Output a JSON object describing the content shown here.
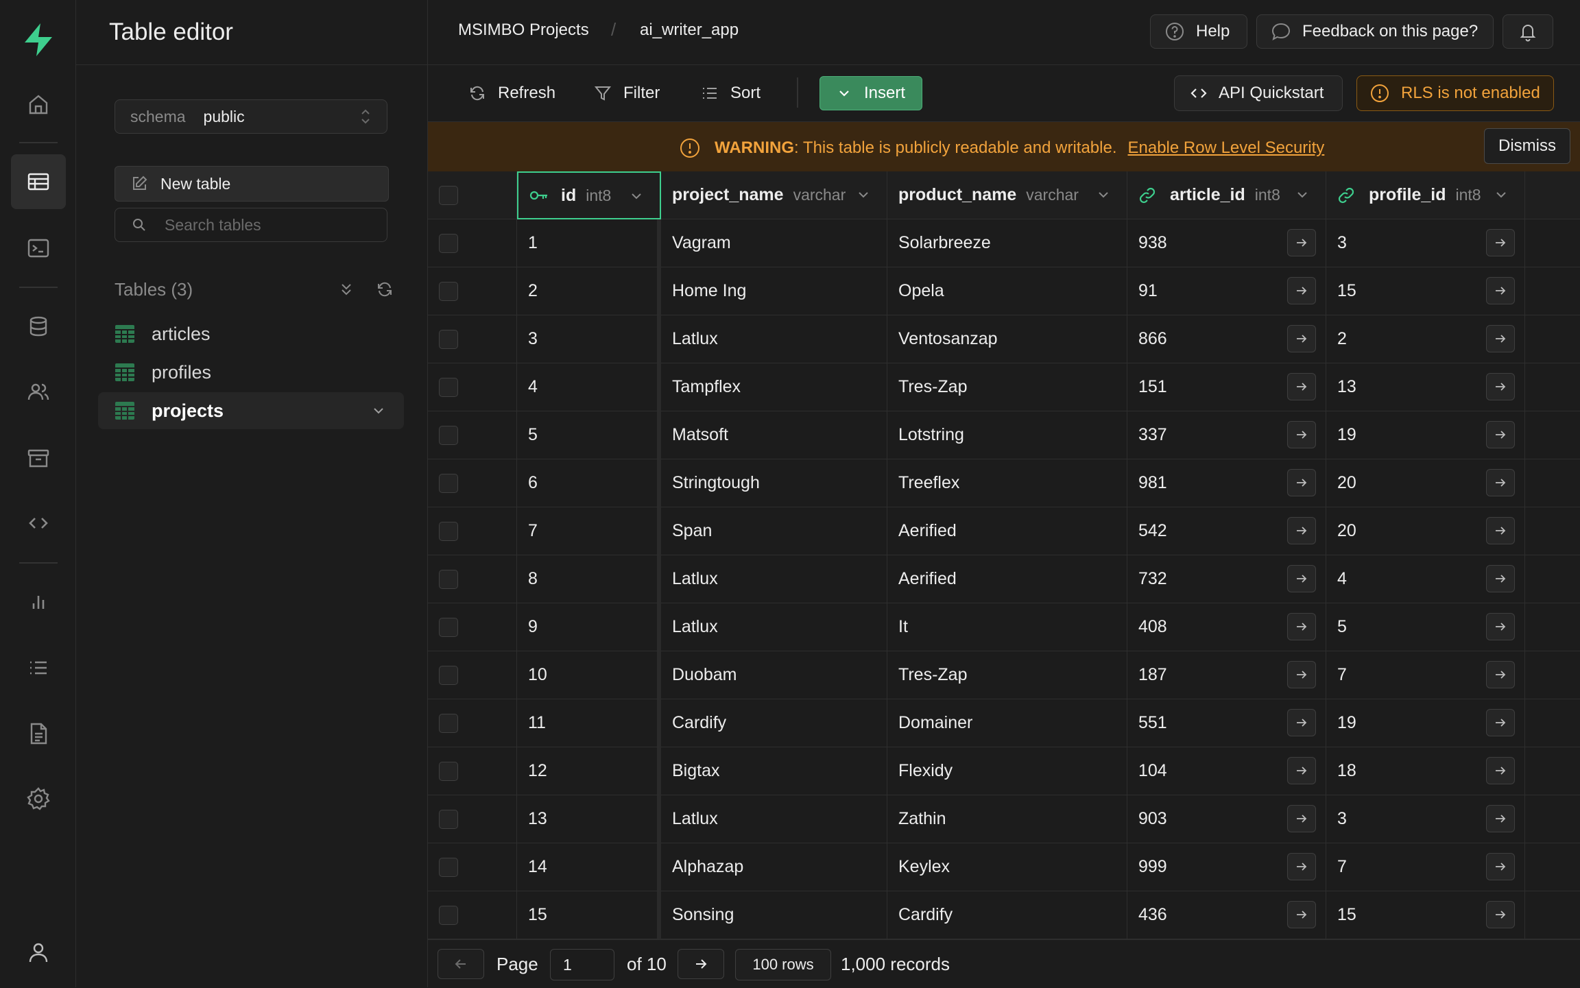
{
  "sidebar": {
    "title": "Table editor",
    "schema_label": "schema",
    "schema_value": "public",
    "new_table_label": "New table",
    "search_placeholder": "Search tables",
    "tables_heading": "Tables (3)",
    "tables": [
      {
        "label": "articles",
        "active": false
      },
      {
        "label": "profiles",
        "active": false
      },
      {
        "label": "projects",
        "active": true
      }
    ]
  },
  "rail": {
    "icons": [
      "logo-icon",
      "home-icon",
      "table-editor-icon",
      "sql-editor-icon",
      "database-icon",
      "users-icon",
      "storage-icon",
      "api-icon",
      "reports-icon",
      "logs-icon",
      "docs-icon",
      "settings-icon",
      "account-icon"
    ],
    "accent": "#3ecf8e"
  },
  "header": {
    "breadcrumb": [
      "MSIMBO Projects",
      "ai_writer_app"
    ],
    "breadcrumb_sep": "/",
    "help_label": "Help",
    "feedback_label": "Feedback on this page?"
  },
  "toolbar": {
    "refresh_label": "Refresh",
    "filter_label": "Filter",
    "sort_label": "Sort",
    "insert_label": "Insert",
    "api_label": "API Quickstart",
    "rls_label": "RLS is not enabled"
  },
  "warning": {
    "prefix": "WARNING",
    "text": ": This table is publicly readable and writable.",
    "link": "Enable Row Level Security",
    "dismiss_label": "Dismiss",
    "color": "#f2a33c"
  },
  "grid": {
    "columns": [
      {
        "name": "id",
        "type": "int8"
      },
      {
        "name": "project_name",
        "type": "varchar"
      },
      {
        "name": "product_name",
        "type": "varchar"
      },
      {
        "name": "article_id",
        "type": "int8"
      },
      {
        "name": "profile_id",
        "type": "int8"
      }
    ],
    "rows": [
      [
        "1",
        "Vagram",
        "Solarbreeze",
        "938",
        "3"
      ],
      [
        "2",
        "Home Ing",
        "Opela",
        "91",
        "15"
      ],
      [
        "3",
        "Latlux",
        "Ventosanzap",
        "866",
        "2"
      ],
      [
        "4",
        "Tampflex",
        "Tres-Zap",
        "151",
        "13"
      ],
      [
        "5",
        "Matsoft",
        "Lotstring",
        "337",
        "19"
      ],
      [
        "6",
        "Stringtough",
        "Treeflex",
        "981",
        "20"
      ],
      [
        "7",
        "Span",
        "Aerified",
        "542",
        "20"
      ],
      [
        "8",
        "Latlux",
        "Aerified",
        "732",
        "4"
      ],
      [
        "9",
        "Latlux",
        "It",
        "408",
        "5"
      ],
      [
        "10",
        "Duobam",
        "Tres-Zap",
        "187",
        "7"
      ],
      [
        "11",
        "Cardify",
        "Domainer",
        "551",
        "19"
      ],
      [
        "12",
        "Bigtax",
        "Flexidy",
        "104",
        "18"
      ],
      [
        "13",
        "Latlux",
        "Zathin",
        "903",
        "3"
      ],
      [
        "14",
        "Alphazap",
        "Keylex",
        "999",
        "7"
      ],
      [
        "15",
        "Sonsing",
        "Cardify",
        "436",
        "15"
      ]
    ]
  },
  "footer": {
    "page_label": "Page",
    "page_value": "1",
    "of_label": "of 10",
    "rows_label": "100 rows",
    "records_label": "1,000 records"
  }
}
